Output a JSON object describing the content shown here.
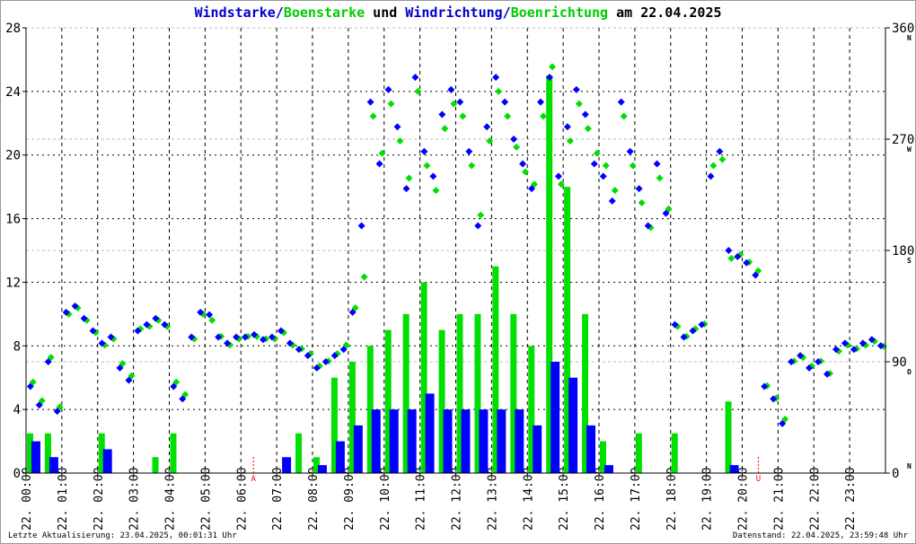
{
  "chart_data": {
    "type": "bar+scatter",
    "title_parts": {
      "wind_speed": "Windstarke",
      "sep1": "/",
      "gust_speed": "Boenstarke",
      "und": " und ",
      "wind_dir": "Windrichtung",
      "sep2": "/",
      "gust_dir": "Boenrichtung",
      "date": " am 22.04.2025"
    },
    "left_axis": {
      "range": [
        0,
        28
      ],
      "ticks": [
        "0",
        "4",
        "8",
        "12",
        "16",
        "20",
        "24",
        "28"
      ]
    },
    "right_axis": {
      "range": [
        0,
        360
      ],
      "ticks": [
        "0",
        "90",
        "180",
        "270",
        "360"
      ],
      "compass": [
        "N",
        "O",
        "S",
        "W",
        "N"
      ]
    },
    "x_range_hours": [
      0,
      24
    ],
    "x_ticks": [
      "22. 00:00",
      "22. 01:00",
      "22. 02:00",
      "22. 03:00",
      "22. 04:00",
      "22. 05:00",
      "22. 06:00",
      "22. 07:00",
      "22. 08:00",
      "22. 09:00",
      "22. 10:00",
      "22. 11:00",
      "22. 12:00",
      "22. 13:00",
      "22. 14:00",
      "22. 15:00",
      "22. 16:00",
      "22. 17:00",
      "22. 18:00",
      "22. 19:00",
      "22. 20:00",
      "22. 21:00",
      "22. 22:00",
      "22. 23:00"
    ],
    "markers": [
      {
        "label": "A",
        "hour": 6.35
      },
      {
        "label": "U",
        "hour": 20.45
      }
    ],
    "half_hour_step": 0.5,
    "wind_speed": [
      2,
      1,
      0,
      0,
      1.5,
      0,
      0,
      0,
      0,
      0,
      0,
      0,
      0,
      0,
      1,
      0,
      0.5,
      2,
      3,
      4,
      4,
      4,
      5,
      4,
      4,
      4,
      4,
      4,
      3,
      7,
      6,
      3,
      0.5,
      0,
      0,
      0,
      0,
      0,
      0,
      0.5,
      0,
      0,
      0,
      0,
      0,
      0,
      0,
      0
    ],
    "gust_speed": [
      2.5,
      2.5,
      0,
      0,
      2.5,
      0,
      0,
      1,
      2.5,
      0,
      0,
      0,
      0,
      0,
      0,
      2.5,
      1,
      6,
      7,
      8,
      9,
      10,
      12,
      9,
      10,
      10,
      13,
      10,
      8,
      25,
      18,
      10,
      2,
      0,
      2.5,
      0,
      2.5,
      0,
      0,
      4.5,
      0,
      0,
      0,
      0,
      0,
      0,
      0,
      0
    ],
    "quarter_hour_step": 0.25,
    "wind_dir": [
      70,
      55,
      90,
      50,
      130,
      135,
      125,
      115,
      105,
      110,
      85,
      75,
      115,
      120,
      125,
      120,
      70,
      60,
      110,
      130,
      128,
      110,
      105,
      110,
      110,
      112,
      108,
      110,
      115,
      105,
      100,
      95,
      85,
      90,
      95,
      100,
      130,
      200,
      300,
      250,
      310,
      280,
      230,
      320,
      260,
      240,
      290,
      310,
      300,
      260,
      200,
      280,
      320,
      300,
      270,
      250,
      230,
      300,
      320,
      240,
      280,
      310,
      290,
      250,
      240,
      220,
      300,
      260,
      230,
      200,
      250,
      210,
      120,
      110,
      115,
      120,
      240,
      260,
      180,
      175,
      170,
      160,
      70,
      60,
      40,
      90,
      95,
      85,
      90,
      80,
      100,
      105,
      100,
      105,
      108,
      103
    ],
    "gust_dir": [
      75,
      60,
      95,
      55,
      130,
      135,
      125,
      115,
      105,
      110,
      90,
      80,
      118,
      120,
      125,
      120,
      75,
      65,
      110,
      130,
      125,
      112,
      105,
      110,
      112,
      112,
      110,
      110,
      115,
      105,
      102,
      98,
      88,
      92,
      98,
      105,
      135,
      160,
      290,
      260,
      300,
      270,
      240,
      310,
      250,
      230,
      280,
      300,
      290,
      250,
      210,
      270,
      310,
      290,
      265,
      245,
      235,
      290,
      330,
      235,
      270,
      300,
      280,
      260,
      250,
      230,
      290,
      250,
      220,
      200,
      240,
      215,
      120,
      112,
      118,
      122,
      250,
      255,
      175,
      178,
      172,
      165,
      72,
      62,
      45,
      92,
      95,
      88,
      92,
      82,
      100,
      105,
      102,
      105,
      108,
      104
    ]
  },
  "footer": {
    "left": "Letzte Aktualisierung: 23.04.2025, 00:01:31 Uhr",
    "right": "Datenstand: 22.04.2025, 23:59:48 Uhr"
  },
  "colors": {
    "wind": "#0000ff",
    "gust": "#00e000",
    "marker": "#ff0000"
  }
}
